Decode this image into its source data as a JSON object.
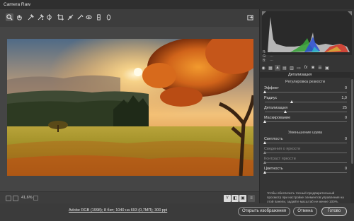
{
  "window": {
    "title": "Camera Raw"
  },
  "toolbar": {
    "tools": [
      "zoom-icon",
      "hand-icon",
      "white-balance-icon",
      "color-sampler-icon",
      "targeted-adjustment-icon",
      "crop-icon",
      "straighten-icon",
      "spot-removal-icon",
      "red-eye-icon",
      "adjustment-brush-icon",
      "graduated-filter-icon",
      "radial-filter-icon"
    ],
    "export_icon": "open-in-photoshop-icon"
  },
  "histogram": {
    "r_label": "R:",
    "g_label": "G:",
    "b_label": "B:",
    "r_value": "---",
    "g_value": "---",
    "b_value": "---"
  },
  "panel": {
    "section_title": "Детализация",
    "sharpening": {
      "title": "Регулировка резкости",
      "amount": {
        "label": "Эффект",
        "value": "0",
        "level": 0.0
      },
      "radius": {
        "label": "Радиус",
        "value": "1,0",
        "level": 0.33
      },
      "detail": {
        "label": "Детализация",
        "value": "25",
        "level": 0.25
      },
      "masking": {
        "label": "Маскирование",
        "value": "0",
        "level": 0.0
      }
    },
    "noise": {
      "title": "Уменьшение шума",
      "luminance": {
        "label": "Светлость",
        "value": "0",
        "level": 0.0
      },
      "luminance_detail": {
        "label": "Сведения о яркости",
        "value": "",
        "level": 0.0
      },
      "luminance_contrast": {
        "label": "Контраст яркости",
        "value": "",
        "level": 0.0
      },
      "color": {
        "label": "Цветность",
        "value": "0",
        "level": 0.0
      }
    },
    "note": "Чтобы обеспечить точный предварительный просмотр при настройке элементов управления на этой панели, задайте масштаб не менее 100%."
  },
  "bottombar": {
    "zoom": "41,6%",
    "view_buttons": [
      "Y",
      "◧",
      "▣"
    ]
  },
  "footer": {
    "info_link": "Adobe RGB (1998); 8 бит; 1040 на 693 (0,7МП); 300 ppi",
    "open_button": "Открыть изображения",
    "cancel_button": "Отмена",
    "done_button": "Готово"
  },
  "colors": {
    "accent": "#e07a1f",
    "panel_bg": "#353535",
    "canvas_bg": "#454545"
  }
}
